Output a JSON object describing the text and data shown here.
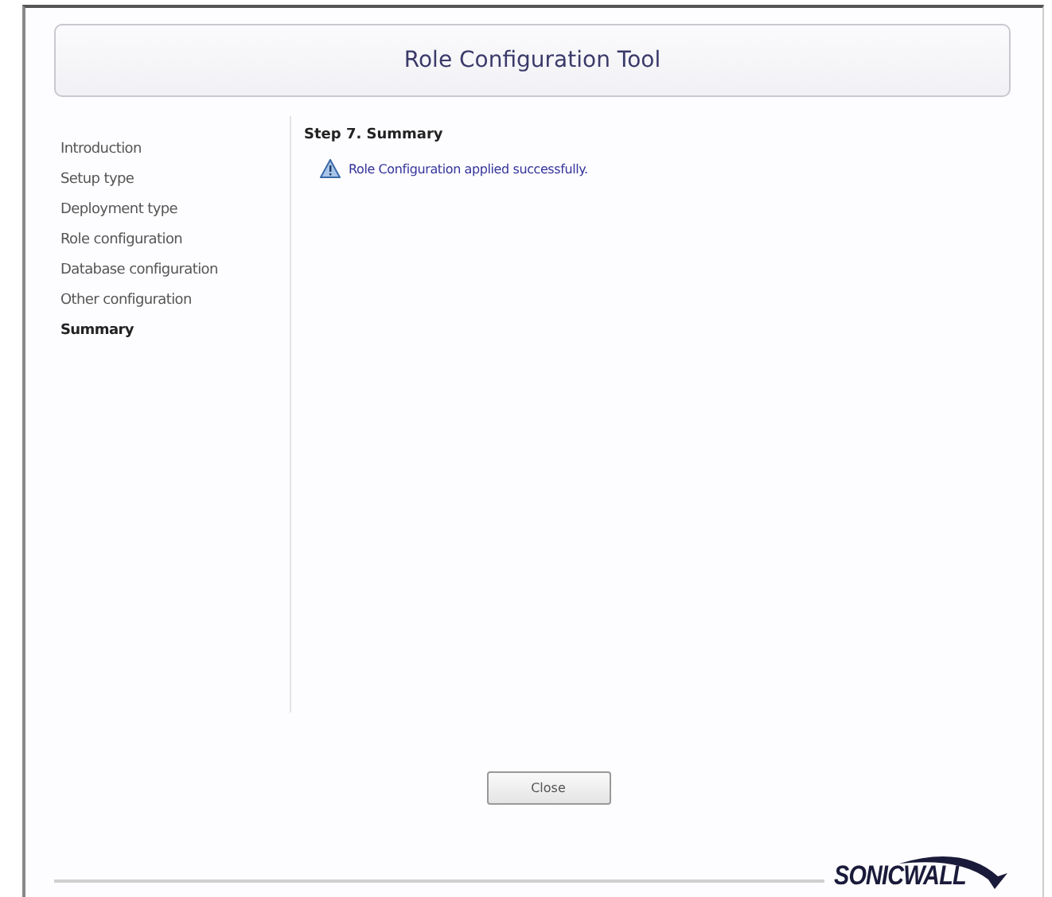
{
  "window": {
    "title": "Role Configuration Tool"
  },
  "steps": [
    {
      "label": "Introduction",
      "selected": false
    },
    {
      "label": "Setup type",
      "selected": false
    },
    {
      "label": "Deployment type",
      "selected": false
    },
    {
      "label": "Role configuration",
      "selected": false
    },
    {
      "label": "Database configuration",
      "selected": false
    },
    {
      "label": "Other configuration",
      "selected": false
    },
    {
      "label": "Summary",
      "selected": true
    }
  ],
  "content": {
    "heading": "Step 7. Summary",
    "message": "Role Configuration applied successfully."
  },
  "buttons": [
    "Close"
  ],
  "logo": {
    "text": "SONICWALL"
  }
}
